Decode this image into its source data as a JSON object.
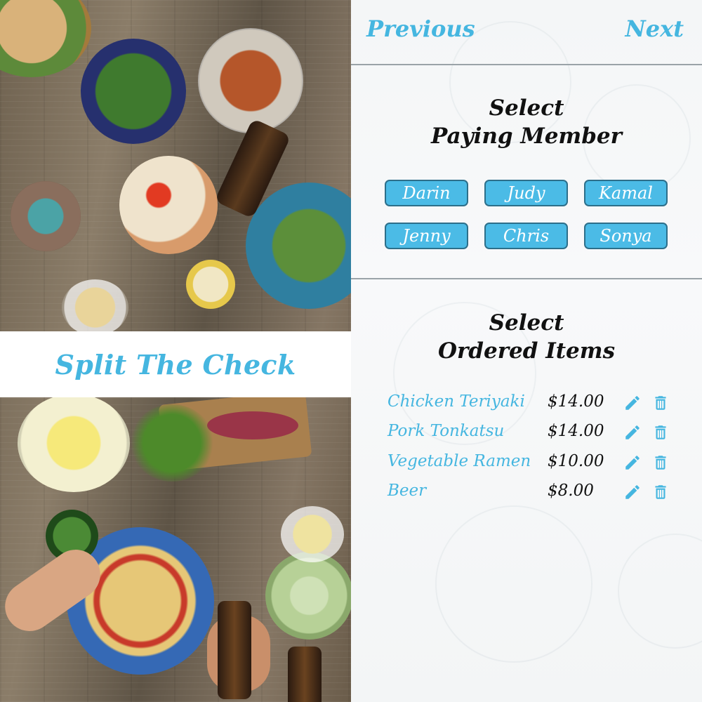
{
  "banner": {
    "title": "Split The Check"
  },
  "nav": {
    "previous_label": "Previous",
    "next_label": "Next"
  },
  "paying_member": {
    "title_line1": "Select",
    "title_line2": "Paying Member",
    "members": [
      "Darin",
      "Judy",
      "Kamal",
      "Jenny",
      "Chris",
      "Sonya"
    ]
  },
  "ordered_items": {
    "title_line1": "Select",
    "title_line2": "Ordered Items",
    "items": [
      {
        "name": "Chicken Teriyaki",
        "price": "$14.00"
      },
      {
        "name": "Pork Tonkatsu",
        "price": "$14.00"
      },
      {
        "name": "Vegetable Ramen",
        "price": "$10.00"
      },
      {
        "name": "Beer",
        "price": "$8.00"
      }
    ]
  },
  "icons": {
    "edit": "pencil-icon",
    "delete": "trash-icon"
  },
  "colors": {
    "accent": "#45b6e0",
    "button_fill": "#4bbbe6",
    "button_border": "#2d6f8a",
    "heading": "#111111"
  }
}
